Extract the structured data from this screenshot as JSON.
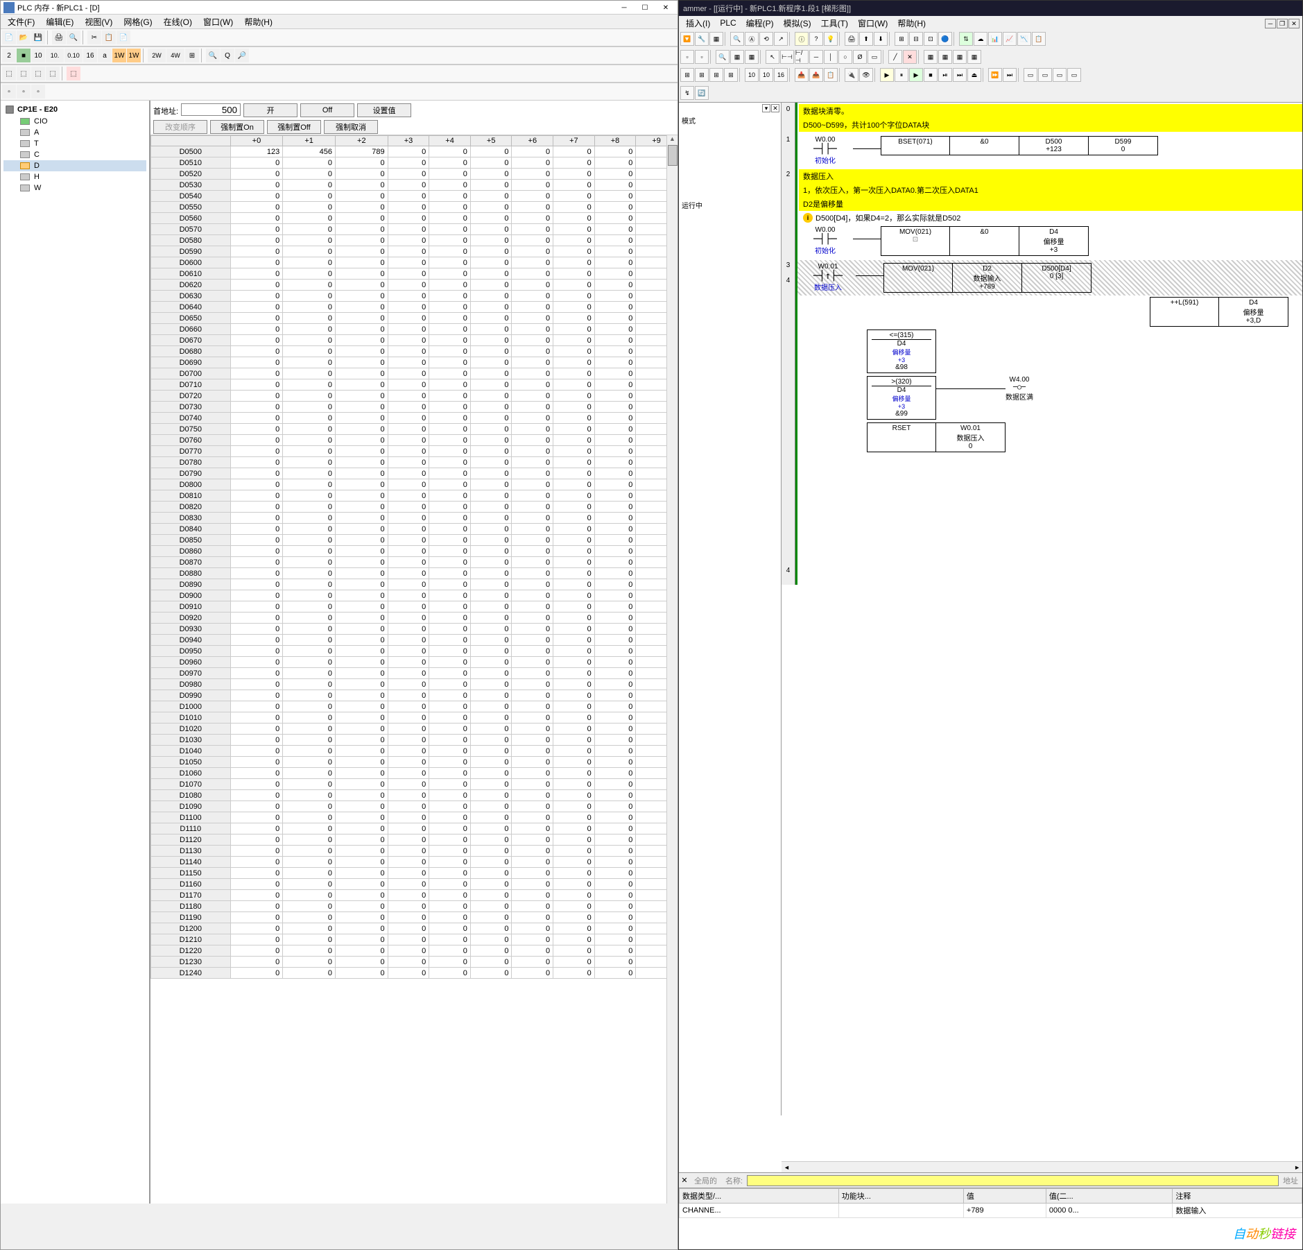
{
  "left": {
    "title": "PLC 内存 - 新PLC1 - [D]",
    "menu": [
      "文件(F)",
      "编辑(E)",
      "视图(V)",
      "网格(G)",
      "在线(O)",
      "窗口(W)",
      "帮助(H)"
    ],
    "tree": {
      "root": "CP1E - E20",
      "items": [
        "CIO",
        "A",
        "T",
        "C",
        "D",
        "H",
        "W"
      ]
    },
    "mem": {
      "first_addr_label": "首地址:",
      "first_addr_value": "500",
      "btn_on": "开",
      "btn_off": "Off",
      "btn_setval": "设置值",
      "btn_order": "改变顺序",
      "btn_forceon": "强制置On",
      "btn_forceoff": "强制置Off",
      "btn_forcecancel": "强制取消",
      "cols": [
        "+0",
        "+1",
        "+2",
        "+3",
        "+4",
        "+5",
        "+6",
        "+7",
        "+8",
        "+9"
      ],
      "start": 500,
      "end": 1240,
      "row0": [
        "123",
        "456",
        "789",
        "0",
        "0",
        "0",
        "0",
        "0",
        "0",
        "0"
      ]
    }
  },
  "right": {
    "title": "ammer - [[运行中] - 新PLC1.新程序1.段1 [梯形图]]",
    "menu": [
      "插入(I)",
      "PLC",
      "编程(P)",
      "模拟(S)",
      "工具(T)",
      "窗口(W)",
      "帮助(H)"
    ],
    "status_text": "运行中",
    "mode_text": "模式",
    "rungs": {
      "r0": {
        "c1": "数据块清零。",
        "c2": "D500~D599，共计100个字位DATA块"
      },
      "r1": {
        "contact": "W0.00",
        "contact_label": "初始化",
        "instr": "BSET(071)",
        "p1": "&0",
        "p2": "D500",
        "p2v": "+123",
        "p3": "D599",
        "p3v": "0"
      },
      "r2": {
        "c1": "数据压入",
        "c2": "1，依次压入，第一次压入DATA0.第二次压入DATA1",
        "c3": "D2是偏移量",
        "info": "D500[D4]，如果D4=2，那么实际就是D502",
        "contact1": "W0.00",
        "contact1_label": "初始化",
        "mov1": "MOV(021)",
        "mov1_p1": "&0",
        "mov1_p2": "D4",
        "mov1_p2_label": "偏移量",
        "mov1_p2_v": "+3"
      },
      "r3": {
        "contact": "W0.01",
        "contact_label": "数据压入",
        "mov": "MOV(021)",
        "mov_p1": "D2",
        "mov_p1_label": "数据输入",
        "mov_p1_v": "+789",
        "mov_p2": "D500[D4]",
        "mov_p2_v": "0 [3]",
        "incl": "++L(591)",
        "incl_p": "D4",
        "incl_label": "偏移量",
        "incl_v": "+3,D",
        "cmp1": "<=(315)",
        "cmp1_p": "D4",
        "cmp1_label": "偏移量",
        "cmp1_v1": "+3",
        "cmp1_v2": "&98",
        "cmp2": ">(320)",
        "cmp2_p": "D4",
        "cmp2_label": "偏移量",
        "cmp2_v1": "+3",
        "cmp2_v2": "&99",
        "out1": "W4.00",
        "out1_label": "数据区满",
        "rset": "RSET",
        "rset_p": "W0.01",
        "rset_label": "数据压入",
        "rset_v": "0"
      }
    },
    "name_label": "名称:",
    "global_label": "全局的",
    "addr_label": "地址",
    "watch": {
      "cols": [
        "数据类型/...",
        "功能块...",
        "值",
        "值(二...",
        "注释"
      ],
      "row": [
        "CHANNE...",
        "",
        "+789",
        "0000 0...",
        "数据输入"
      ]
    }
  },
  "watermark": "自动秒链接"
}
